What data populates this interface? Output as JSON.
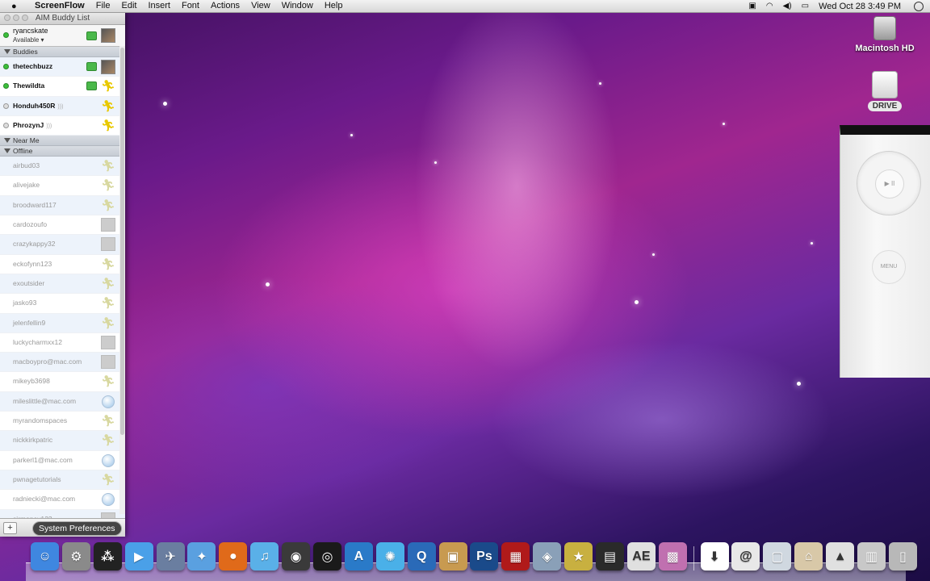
{
  "menubar": {
    "app": "ScreenFlow",
    "items": [
      "File",
      "Edit",
      "Insert",
      "Font",
      "Actions",
      "View",
      "Window",
      "Help"
    ],
    "clock": "Wed Oct 28  3:49 PM"
  },
  "aim": {
    "title": "AIM Buddy List",
    "me": {
      "name": "ryancskate",
      "status": "Available ▾"
    },
    "groups": {
      "buddies": "Buddies",
      "near_me": "Near Me",
      "offline": "Offline"
    },
    "online": [
      {
        "name": "thetechbuzz",
        "icon": "video-icon"
      },
      {
        "name": "Thewildta",
        "icon": "phone-icon"
      },
      {
        "name": "Honduh450R",
        "icon": "feed-icon"
      },
      {
        "name": "PhrozynJ",
        "icon": "feed-icon"
      }
    ],
    "offline": [
      "airbud03",
      "alivejake",
      "broodward117",
      "cardozoufo",
      "crazykappy32",
      "eckofynn123",
      "exoutsider",
      "jasko93",
      "jelenfellin9",
      "luckycharmxx12",
      "macboypro@mac.com",
      "mikeyb3698",
      "mileslittle@mac.com",
      "myrandomspaces",
      "nickkirkpatric",
      "parkerl1@mac.com",
      "pwnagetutorials",
      "radniecki@mac.com",
      "sirmoney123"
    ],
    "add_label": "+"
  },
  "tooltip": "System Preferences",
  "desktop": {
    "hd_label": "Macintosh HD",
    "drive_label": "DRIVE"
  },
  "remote": {
    "play": "▶ II",
    "menu": "MENU"
  },
  "dock": {
    "apps": [
      {
        "name": "finder-icon",
        "glyph": "☺",
        "bg": "#3f87e0"
      },
      {
        "name": "system-preferences-icon",
        "glyph": "⚙",
        "bg": "#8a8a8a"
      },
      {
        "name": "blackberry-icon",
        "glyph": "⁂",
        "bg": "#222222"
      },
      {
        "name": "ichat-icon",
        "glyph": "▶",
        "bg": "#4aa0e8"
      },
      {
        "name": "ducky-icon",
        "glyph": "✈",
        "bg": "#6a7ea0"
      },
      {
        "name": "safari-icon",
        "glyph": "✦",
        "bg": "#5aa0e0"
      },
      {
        "name": "firefox-icon",
        "glyph": "●",
        "bg": "#e06a1a"
      },
      {
        "name": "itunes-icon",
        "glyph": "♫",
        "bg": "#5ab0e8"
      },
      {
        "name": "camino-icon",
        "glyph": "◉",
        "bg": "#3a3a3a"
      },
      {
        "name": "dvd-icon",
        "glyph": "◎",
        "bg": "#1a1a1a"
      },
      {
        "name": "xcode-icon",
        "glyph": "A",
        "bg": "#2a7ac8"
      },
      {
        "name": "network-icon",
        "glyph": "✺",
        "bg": "#4ab0e8"
      },
      {
        "name": "quicktime-icon",
        "glyph": "Q",
        "bg": "#2a6ab8"
      },
      {
        "name": "iphoto-icon",
        "glyph": "▣",
        "bg": "#c89a50"
      },
      {
        "name": "photoshop-icon",
        "glyph": "Ps",
        "bg": "#1a4a8a"
      },
      {
        "name": "photobooth-icon",
        "glyph": "▦",
        "bg": "#b01a1a"
      },
      {
        "name": "preview-icon",
        "glyph": "◈",
        "bg": "#8aa0b8"
      },
      {
        "name": "imovie-icon",
        "glyph": "★",
        "bg": "#c8b040"
      },
      {
        "name": "final-cut-icon",
        "glyph": "▤",
        "bg": "#2a2a2a"
      },
      {
        "name": "after-effects-icon",
        "glyph": "AE",
        "bg": "#e0e0e0"
      },
      {
        "name": "iphoto-library-icon",
        "glyph": "▩",
        "bg": "#c070b0"
      }
    ],
    "docs": [
      {
        "name": "downloads-icon",
        "glyph": "⬇",
        "bg": "#ffffff"
      },
      {
        "name": "sites-icon",
        "glyph": "@",
        "bg": "#e8e8e8"
      },
      {
        "name": "user-folder-icon",
        "glyph": "▢",
        "bg": "#d0d8e0"
      },
      {
        "name": "documents-icon",
        "glyph": "⌂",
        "bg": "#d8c8a8"
      },
      {
        "name": "applications-icon",
        "glyph": "▲",
        "bg": "#e0e0e0"
      },
      {
        "name": "folder-icon",
        "glyph": "▥",
        "bg": "#c8c8c8"
      },
      {
        "name": "trash-icon",
        "glyph": "▯",
        "bg": "#b8b8b8"
      }
    ]
  }
}
